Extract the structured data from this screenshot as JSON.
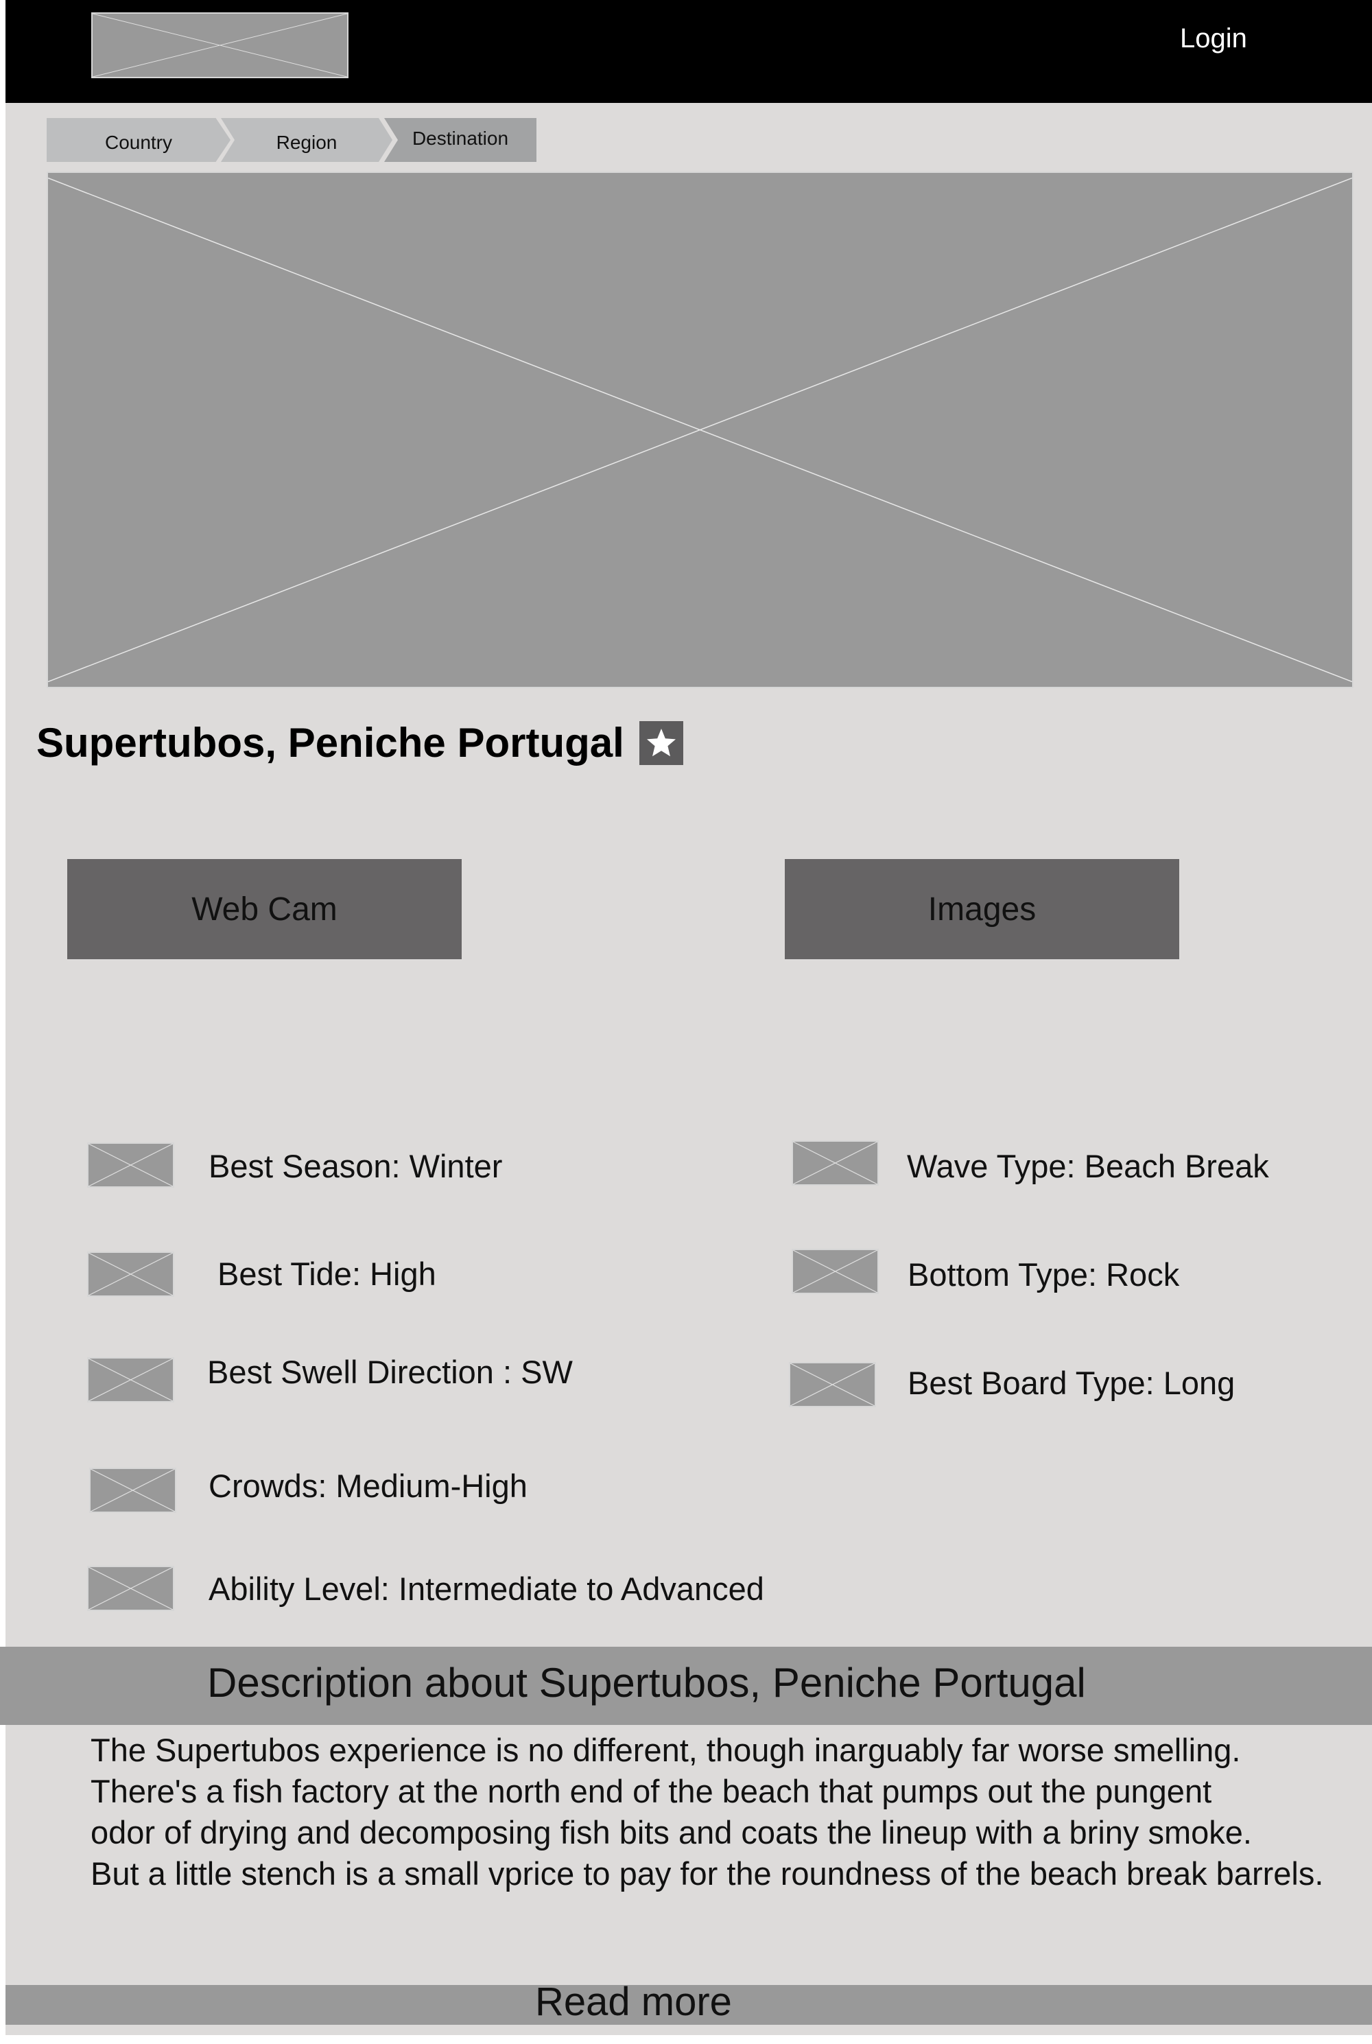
{
  "header": {
    "login_label": "Login"
  },
  "breadcrumb": {
    "items": [
      "Country",
      "Region",
      "Destination"
    ]
  },
  "spot": {
    "title": "Supertubos, Peniche Portugal"
  },
  "actions": {
    "webcam_label": "Web Cam",
    "images_label": "Images"
  },
  "attributes": {
    "best_season": "Best Season: Winter",
    "best_tide": "Best Tide: High",
    "best_swell": "Best Swell Direction : SW",
    "crowds": "Crowds: Medium-High",
    "ability": "Ability Level: Intermediate to Advanced",
    "wave_type": "Wave Type: Beach Break",
    "bottom_type": "Bottom Type: Rock",
    "board_type": "Best Board Type: Long"
  },
  "description": {
    "heading": "Description about Supertubos, Peniche Portugal",
    "lines": [
      "The Supertubos experience is no different, though  inarguably far worse smelling.",
      "There's a fish factory at the north end of the beach that pumps out the pungent",
      "odor of drying and decomposing fish bits and coats the lineup with a briny smoke.",
      "But a little stench is a small vprice to pay for the roundness of the beach break barrels."
    ],
    "read_more_label": "Read more"
  },
  "colors": {
    "header_bg": "#000000",
    "page_bg": "#dddbda",
    "button_bg": "#666465",
    "placeholder": "#999999"
  }
}
